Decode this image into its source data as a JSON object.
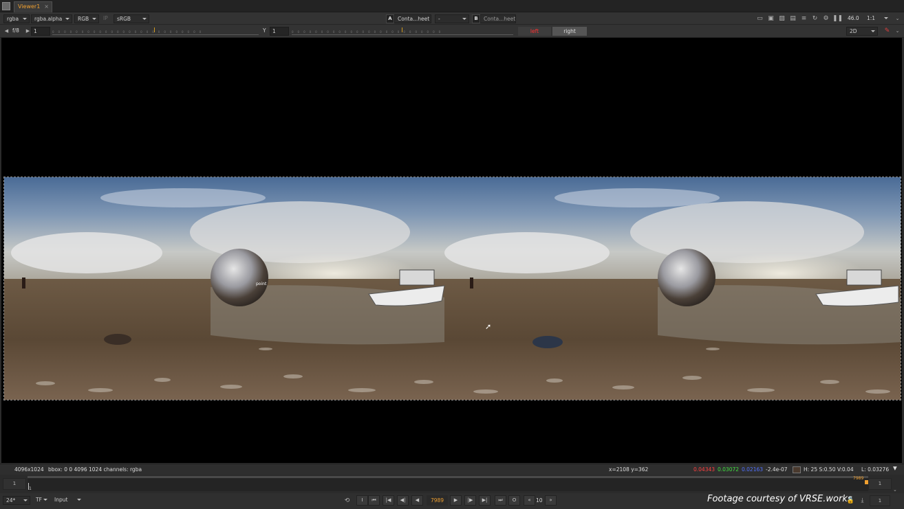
{
  "tab": {
    "title": "Viewer1",
    "close": "×"
  },
  "toolbar1": {
    "channels": "rgba",
    "alpha": "rgba.alpha",
    "display": "RGB",
    "ip": "IP",
    "lut": "sRGB",
    "a_label": "A",
    "a_input": "Conta...heet",
    "compare_mode": "-",
    "b_label": "B",
    "b_input": "Conta...heet",
    "gain_label": "46.0",
    "zoom": "1:1",
    "icons": [
      "roi-icon",
      "fit-icon",
      "clip-warning-icon",
      "overlay-icon",
      "lines-icon",
      "refresh-icon",
      "sync-icon",
      "pause-icon"
    ]
  },
  "toolbar2": {
    "fstop": "f/8",
    "gain_value": "1",
    "gamma_label": "Y",
    "gamma_value": "1",
    "eye_left": "left",
    "eye_right": "right",
    "view_mode": "2D"
  },
  "viewer": {
    "image_desc_colors": {
      "sky": "#5a7ca8",
      "sand": "#6b5640"
    },
    "point_label": "point"
  },
  "infobar": {
    "format": "4096x1024",
    "bbox": "bbox: 0 0 4096 1024 channels: rgba",
    "coords": "x=2108 y=362",
    "r": "0.04343",
    "g": "0.03072",
    "b": "0.02163",
    "a": "-2.4e-07",
    "hsv": "H: 25 S:0.50 V:0.04",
    "lum": "L: 0.03276",
    "colors": {
      "r": "#ff4040",
      "g": "#40e040",
      "b": "#5070ff"
    }
  },
  "timeline": {
    "in_frame": "1",
    "out_frame": "1",
    "playhead_label": "7989",
    "start_label": "1"
  },
  "controls": {
    "fps": "24*",
    "tf": "TF",
    "input": "Input",
    "current_frame": "7989",
    "step": "10",
    "end_frame": "1",
    "credit": "Footage courtesy of VRSE.works"
  }
}
